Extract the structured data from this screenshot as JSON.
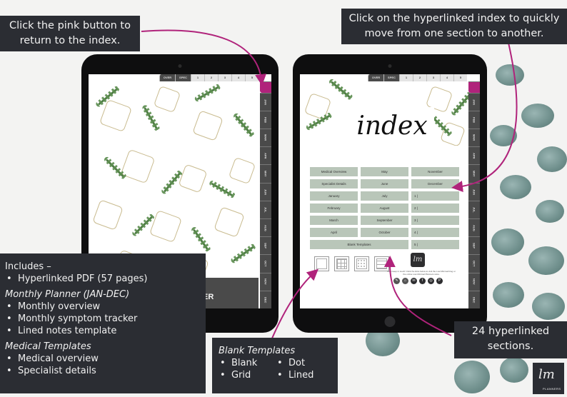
{
  "callouts": {
    "pink_button": "Click the pink button to return to the index.",
    "hyperlinked_index": "Click on the hyperlinked index to quickly move from one section to another.",
    "sections": "24 hyperlinked sections."
  },
  "includes": {
    "heading": "Includes –",
    "items": [
      "Hyperlinked PDF (57 pages)"
    ],
    "monthly_heading": "Monthly Planner (JAN-DEC)",
    "monthly_items": [
      "Monthly overview",
      "Monthly symptom tracker",
      "Lined notes template"
    ],
    "medical_heading": "Medical Templates",
    "medical_items": [
      "Medical overview",
      "Specialist details"
    ]
  },
  "blank_templates": {
    "heading": "Blank Templates",
    "items": [
      "Blank",
      "Dot",
      "Grid",
      "Lined"
    ]
  },
  "planner": {
    "top_tabs": [
      "OVER",
      "SPEC",
      "1",
      "2",
      "3",
      "4",
      "5"
    ],
    "side_tabs": [
      "JAN",
      "FEB",
      "MAR",
      "APR",
      "MAY",
      "JUN",
      "JUL",
      "AUG",
      "SEP",
      "OCT",
      "NOV",
      "DEC"
    ],
    "cover_title_fragment": "ER",
    "index_title": "index",
    "index_rows": [
      [
        "Medical Overview",
        "May",
        "November"
      ],
      [
        "Specialist Details",
        "June",
        "December"
      ],
      [
        "January",
        "July",
        "1 |"
      ],
      [
        "February",
        "August",
        "2 |"
      ],
      [
        "March",
        "September",
        "3 |"
      ],
      [
        "April",
        "October",
        "4 |"
      ]
    ],
    "index_last_row": [
      "Blank Templates",
      "5 |"
    ],
    "template_icons": [
      "blank",
      "grid",
      "dot",
      "lined"
    ],
    "brand_text": "Let's keep in touch! Click the links below to visit the Low Minimal blog or the online Low Minimal Planners store.",
    "brand_mark": "lm",
    "socials": [
      "blog",
      "store",
      "email",
      "f",
      "instagram",
      "P"
    ]
  },
  "logo": {
    "mark": "lm",
    "caption": "PLANNERS"
  },
  "colors": {
    "accent_pink": "#b0237b",
    "callout_bg": "#2b2d33",
    "index_cell": "#b9c6b9"
  }
}
